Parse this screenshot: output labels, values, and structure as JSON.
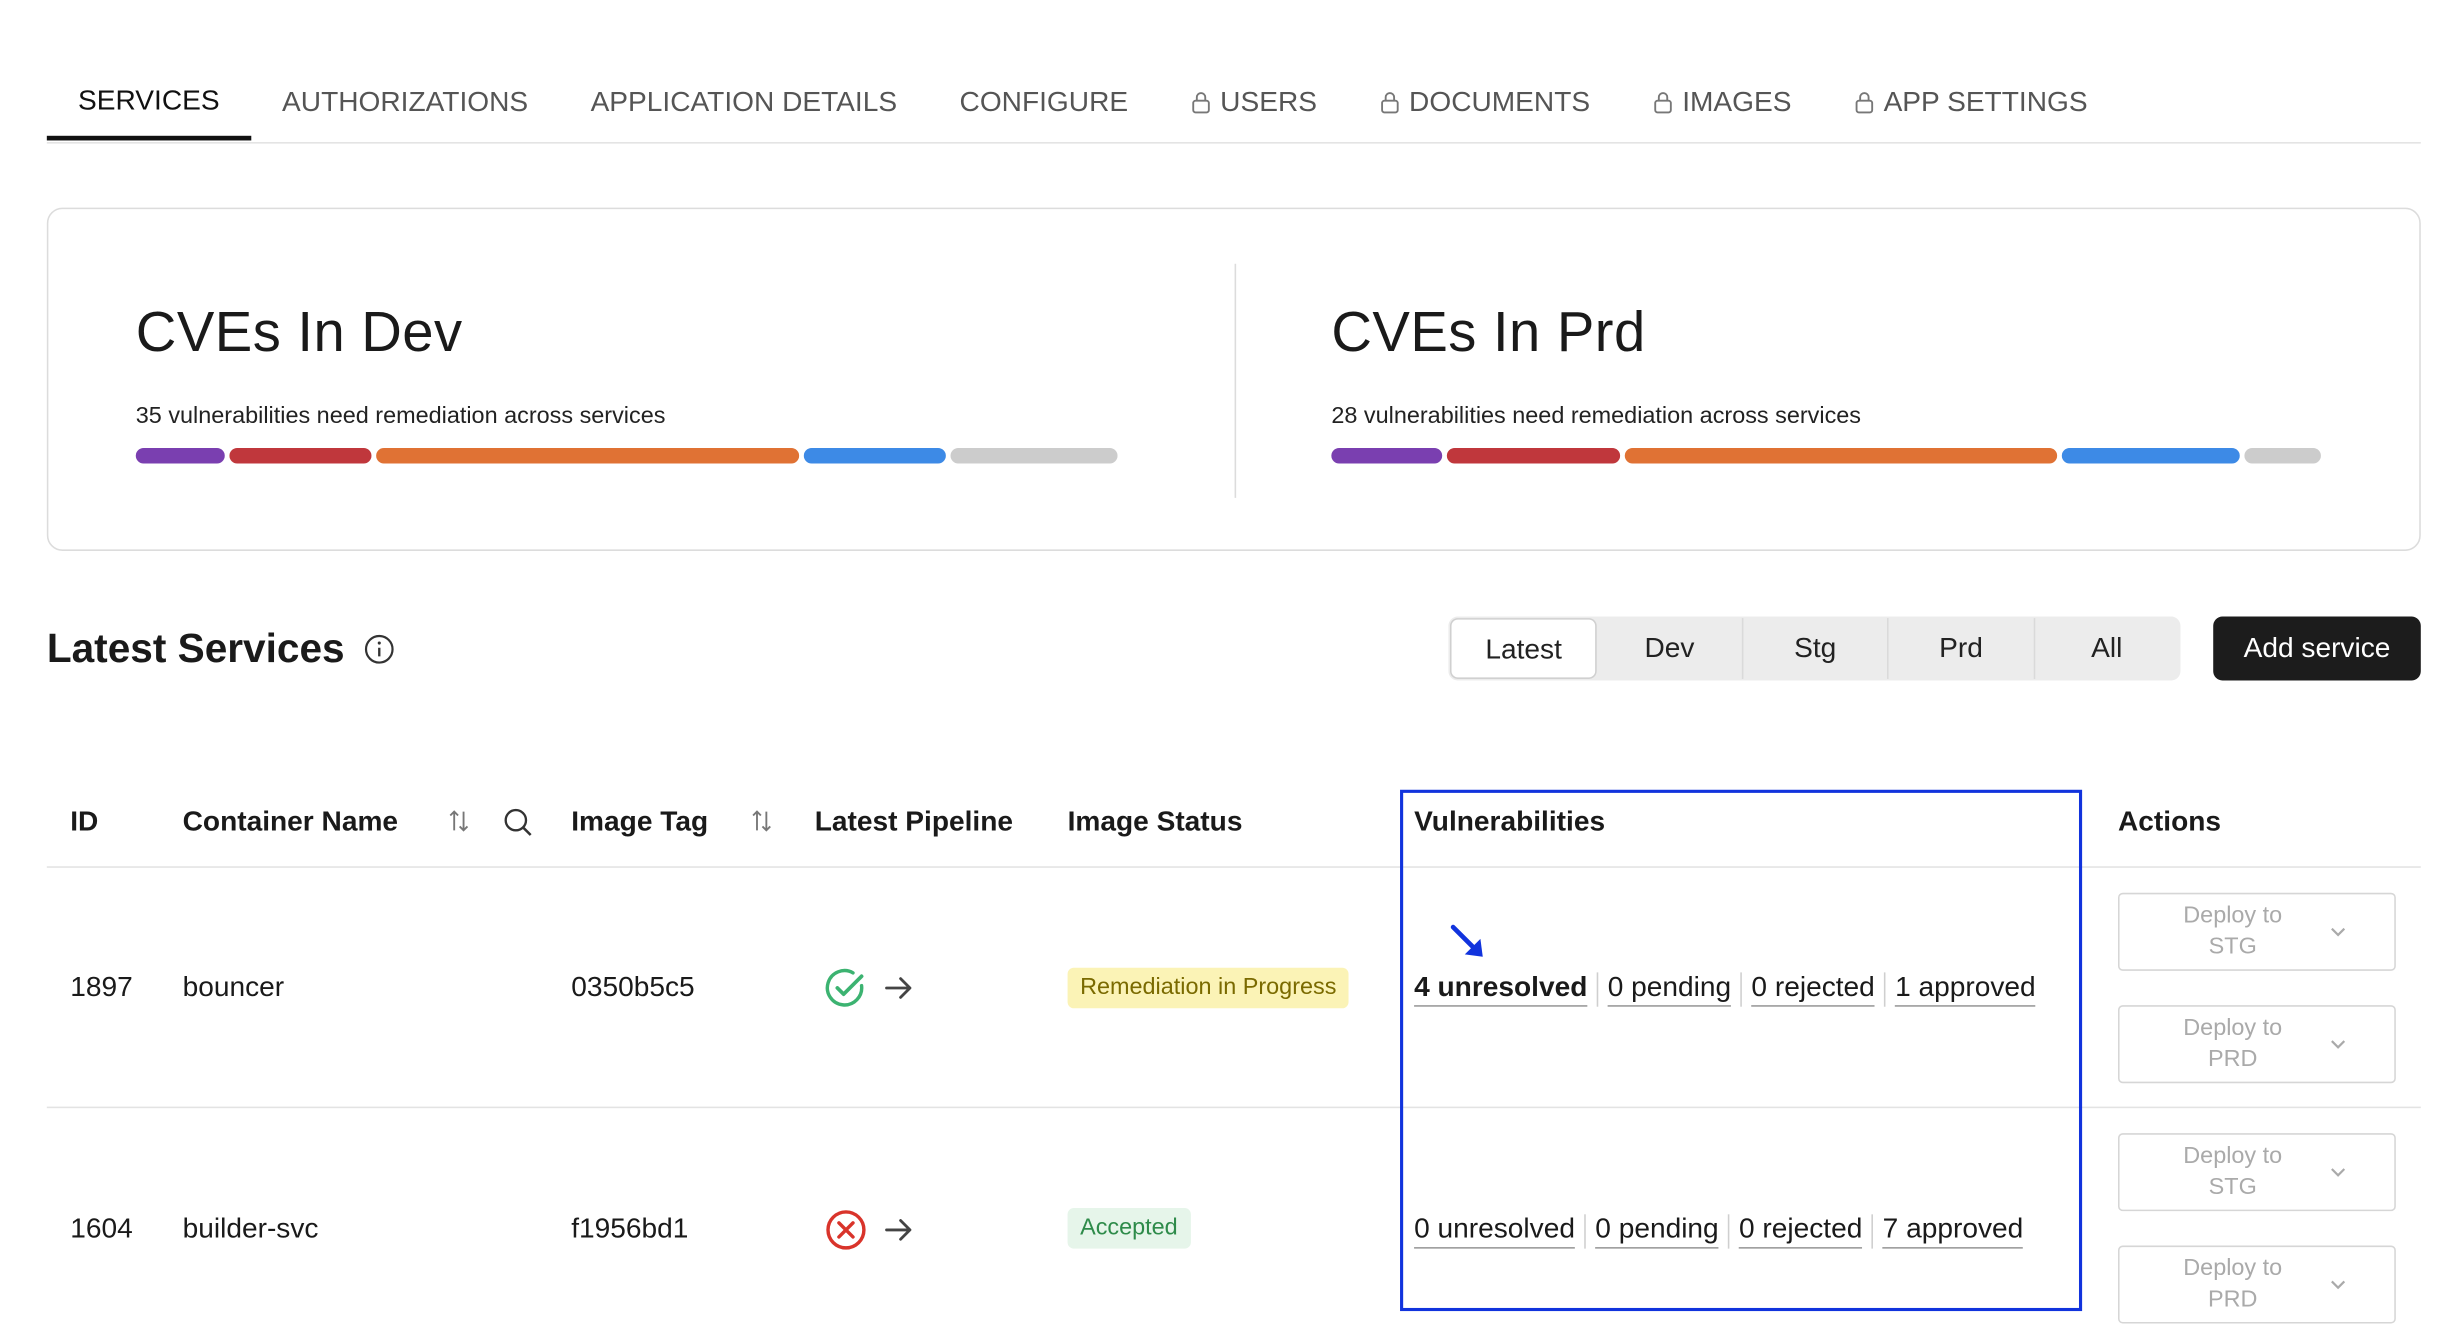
{
  "tabs": [
    {
      "label": "SERVICES",
      "locked": false,
      "active": true
    },
    {
      "label": "AUTHORIZATIONS",
      "locked": false
    },
    {
      "label": "APPLICATION DETAILS",
      "locked": false
    },
    {
      "label": "CONFIGURE",
      "locked": false
    },
    {
      "label": "USERS",
      "locked": true
    },
    {
      "label": "DOCUMENTS",
      "locked": true
    },
    {
      "label": "IMAGES",
      "locked": true
    },
    {
      "label": "APP SETTINGS",
      "locked": true
    }
  ],
  "summary": {
    "dev": {
      "title": "CVEs In Dev",
      "subtitle": "35 vulnerabilities need remediation across services",
      "segment_shares": [
        0.09,
        0.145,
        0.43,
        0.145,
        0.17
      ]
    },
    "prd": {
      "title": "CVEs In Prd",
      "subtitle": "28 vulnerabilities need remediation across services",
      "segment_shares": [
        0.112,
        0.177,
        0.44,
        0.18,
        0.078
      ]
    },
    "segment_colors": [
      "#7a3fb0",
      "#c0373c",
      "#e07234",
      "#3d8ae6",
      "#cccccc"
    ]
  },
  "section": {
    "title": "Latest Services",
    "info_icon": "info-icon",
    "filters": [
      "Latest",
      "Dev",
      "Stg",
      "Prd",
      "All"
    ],
    "active_filter": "Latest",
    "add_label": "Add service"
  },
  "table": {
    "headers": {
      "id": "ID",
      "container": "Container Name",
      "tag": "Image Tag",
      "pipeline": "Latest Pipeline",
      "status": "Image Status",
      "vulns": "Vulnerabilities",
      "actions": "Actions"
    },
    "rows": [
      {
        "id": "1897",
        "container": "bouncer",
        "tag": "0350b5c5",
        "pipeline": "success",
        "status": "Remediation in Progress",
        "vulns": {
          "unresolved": "4 unresolved",
          "pending": "0 pending",
          "rejected": "0 rejected",
          "approved": "1 approved"
        },
        "deploy_stg": [
          "Deploy to",
          "STG"
        ],
        "deploy_prd": [
          "Deploy to",
          "PRD"
        ]
      },
      {
        "id": "1604",
        "container": "builder-svc",
        "tag": "f1956bd1",
        "pipeline": "failed",
        "status": "Accepted",
        "vulns": {
          "unresolved": "0 unresolved",
          "pending": "0 pending",
          "rejected": "0 rejected",
          "approved": "7 approved"
        },
        "deploy_stg": [
          "Deploy to",
          "STG"
        ],
        "deploy_prd": [
          "Deploy to",
          "PRD"
        ]
      }
    ]
  },
  "colors": {
    "accent_highlight": "#1133dd",
    "success": "#3cb371",
    "failure": "#d9342b",
    "remediation_bg": "#fbf3b6",
    "remediation_text": "#7a6a00",
    "accepted_bg": "#e6f5ea",
    "accepted_text": "#2e8b4a"
  }
}
